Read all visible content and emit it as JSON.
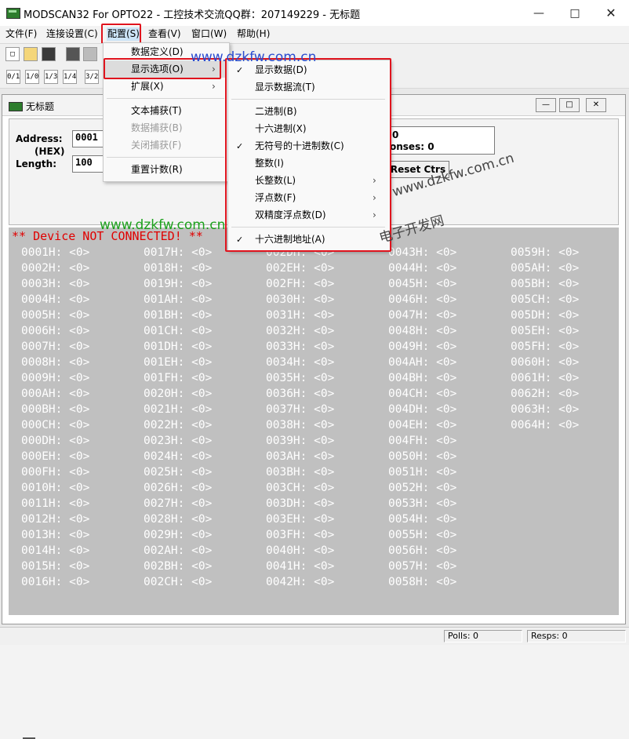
{
  "window": {
    "title": "MODSCAN32 For OPTO22 - 工控技术交流QQ群：207149229 - 无标题"
  },
  "menubar": [
    "文件(F)",
    "连接设置(C)",
    "配置(S)",
    "查看(V)",
    "窗口(W)",
    "帮助(H)"
  ],
  "toolbar2_icons": [
    "0/1",
    "1/0",
    "1/3",
    "1/4",
    "3/2"
  ],
  "child": {
    "title": "无标题",
    "address_label": "Address:",
    "hex_label": "(HEX)",
    "length_label": "Length:",
    "address_value": "0001",
    "length_value": "100",
    "device_line1": "0",
    "device_line2": "onses: 0",
    "reset_button": "Reset Ctrs",
    "status_message": "** Device NOT CONNECTED! **",
    "columns": [
      [
        "0001H: <0>",
        "0002H: <0>",
        "0003H: <0>",
        "0004H: <0>",
        "0005H: <0>",
        "0006H: <0>",
        "0007H: <0>",
        "0008H: <0>",
        "0009H: <0>",
        "000AH: <0>",
        "000BH: <0>",
        "000CH: <0>",
        "000DH: <0>",
        "000EH: <0>",
        "000FH: <0>",
        "0010H: <0>",
        "0011H: <0>",
        "0012H: <0>",
        "0013H: <0>",
        "0014H: <0>",
        "0015H: <0>",
        "0016H: <0>"
      ],
      [
        "0017H: <0>",
        "0018H: <0>",
        "0019H: <0>",
        "001AH: <0>",
        "001BH: <0>",
        "001CH: <0>",
        "001DH: <0>",
        "001EH: <0>",
        "001FH: <0>",
        "0020H: <0>",
        "0021H: <0>",
        "0022H: <0>",
        "0023H: <0>",
        "0024H: <0>",
        "0025H: <0>",
        "0026H: <0>",
        "0027H: <0>",
        "0028H: <0>",
        "0029H: <0>",
        "002AH: <0>",
        "002BH: <0>",
        "002CH: <0>"
      ],
      [
        "002DH: <0>",
        "002EH: <0>",
        "002FH: <0>",
        "0030H: <0>",
        "0031H: <0>",
        "0032H: <0>",
        "0033H: <0>",
        "0034H: <0>",
        "0035H: <0>",
        "0036H: <0>",
        "0037H: <0>",
        "0038H: <0>",
        "0039H: <0>",
        "003AH: <0>",
        "003BH: <0>",
        "003CH: <0>",
        "003DH: <0>",
        "003EH: <0>",
        "003FH: <0>",
        "0040H: <0>",
        "0041H: <0>",
        "0042H: <0>"
      ],
      [
        "0043H: <0>",
        "0044H: <0>",
        "0045H: <0>",
        "0046H: <0>",
        "0047H: <0>",
        "0048H: <0>",
        "0049H: <0>",
        "004AH: <0>",
        "004BH: <0>",
        "004CH: <0>",
        "004DH: <0>",
        "004EH: <0>",
        "004FH: <0>",
        "0050H: <0>",
        "0051H: <0>",
        "0052H: <0>",
        "0053H: <0>",
        "0054H: <0>",
        "0055H: <0>",
        "0056H: <0>",
        "0057H: <0>",
        "0058H: <0>"
      ],
      [
        "0059H: <0>",
        "005AH: <0>",
        "005BH: <0>",
        "005CH: <0>",
        "005DH: <0>",
        "005EH: <0>",
        "005FH: <0>",
        "0060H: <0>",
        "0061H: <0>",
        "0062H: <0>",
        "0063H: <0>",
        "0064H: <0>"
      ]
    ]
  },
  "config_menu": {
    "items": [
      "数据定义(D)",
      "显示选项(O)",
      "扩展(X)",
      "文本捕获(T)",
      "数据捕获(B)",
      "关闭捕获(F)",
      "重置计数(R)"
    ]
  },
  "display_submenu": {
    "items": [
      "显示数据(D)",
      "显示数据流(T)",
      "二进制(B)",
      "十六进制(X)",
      "无符号的十进制数(C)",
      "整数(I)",
      "长整数(L)",
      "浮点数(F)",
      "双精度浮点数(D)",
      "十六进制地址(A)"
    ]
  },
  "statusbar": {
    "polls": "Polls: 0",
    "resps": "Resps: 0"
  },
  "watermarks": {
    "url": "www.dzkfw.com.cn",
    "cn": "电子开发网"
  },
  "colors": {
    "highlight_red": "#e0141e",
    "status_red": "#e00000",
    "data_bg": "#c0c0c0"
  }
}
